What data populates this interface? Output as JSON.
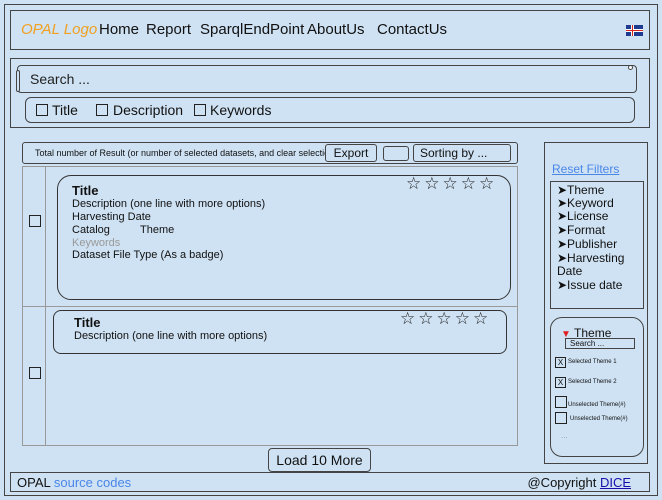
{
  "header": {
    "logo": "OPAL Logo",
    "nav": [
      "Home",
      "Report",
      "SparqlEndPoint",
      "AboutUs",
      "ContactUs"
    ],
    "flag_icon": "iceland-flag-icon"
  },
  "search": {
    "placeholder": "Search ...",
    "fields": [
      {
        "label": "Title",
        "checked": false
      },
      {
        "label": "Description",
        "checked": false
      },
      {
        "label": "Keywords",
        "checked": false
      }
    ]
  },
  "toolbar": {
    "total_text": "Total number of Result (or number of selected datasets, and clear selection)",
    "export_label": "Export",
    "sort_label": "Sorting by ..."
  },
  "results": [
    {
      "title": "Title",
      "description": "Description (one line with more options)",
      "harvesting": "Harvesting Date",
      "catalog": "Catalog",
      "theme": "Theme",
      "keywords": "Keywords",
      "file_type": "Dataset File Type (As a badge)",
      "stars": "☆☆☆☆☆"
    },
    {
      "title": "Title",
      "description": "Description (one line with more options)",
      "stars": "☆☆☆☆☆"
    }
  ],
  "load_more": "Load 10 More",
  "sidebar": {
    "reset": "Reset Filters",
    "facets": [
      "➤Theme",
      "➤Keyword",
      "➤License",
      "➤Format",
      "➤Publisher",
      "➤Harvesting",
      "Date",
      "➤Issue date"
    ],
    "theme": {
      "title": "Theme",
      "search": "Search ...",
      "options": [
        {
          "label": "Selected Theme 1",
          "mark": "X"
        },
        {
          "label": "Selected Theme 2",
          "mark": "X"
        },
        {
          "label": "Unselected Theme(#)",
          "mark": ""
        },
        {
          "label": "Unselected Theme(#)",
          "mark": ""
        }
      ],
      "more": "..."
    }
  },
  "footer": {
    "left_prefix": "OPAL ",
    "left_link": "source codes",
    "right_prefix": "@Copyright ",
    "right_link": "DICE"
  }
}
